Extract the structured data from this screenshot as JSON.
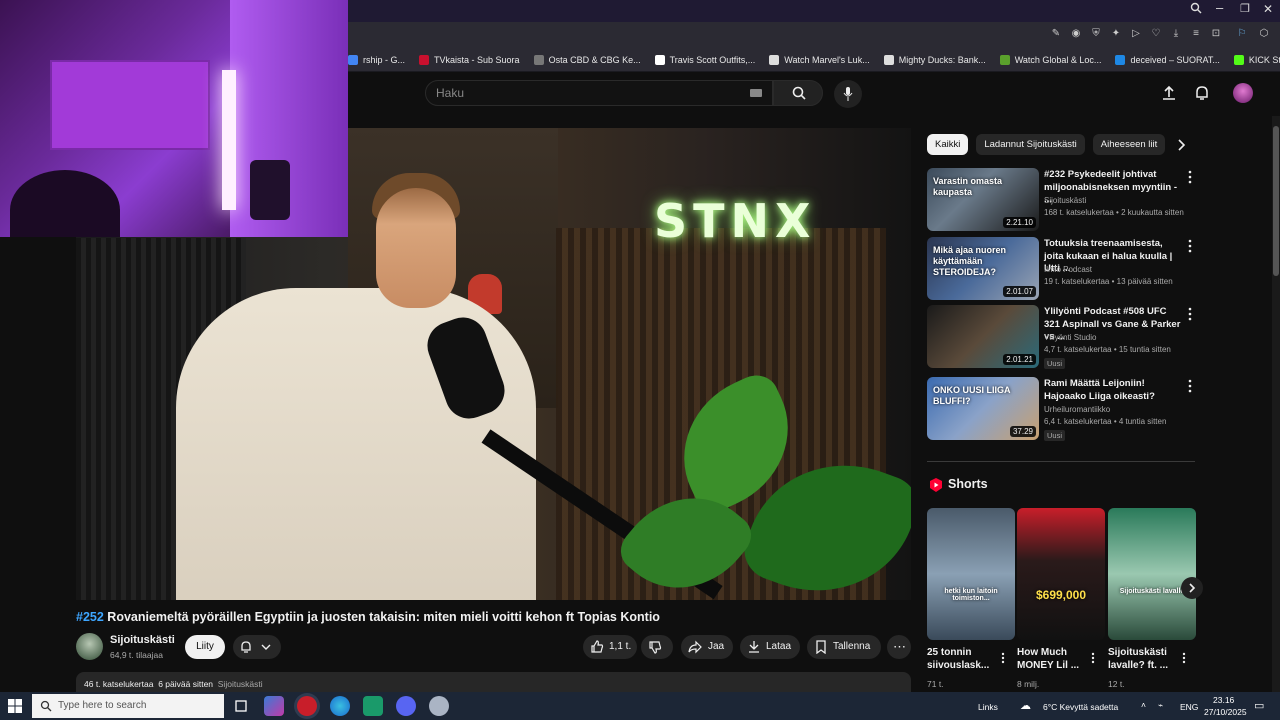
{
  "browser": {
    "bookmarks": [
      {
        "label": "rship - G...",
        "color": "#4285f4"
      },
      {
        "label": "TVkaista - Sub Suora",
        "color": "#c8102e"
      },
      {
        "label": "Osta CBD & CBG Ke...",
        "color": "#777777"
      },
      {
        "label": "Travis Scott Outfits,...",
        "color": "#ffffff"
      },
      {
        "label": "Watch Marvel's Luk...",
        "color": "#dddddd"
      },
      {
        "label": "Mighty Ducks: Bank...",
        "color": "#dddddd"
      },
      {
        "label": "Watch Global & Loc...",
        "color": "#5aa02c"
      },
      {
        "label": "deceived – SUORAT...",
        "color": "#1e88e5"
      },
      {
        "label": "KICK Status Page",
        "color": "#53fc18"
      }
    ]
  },
  "youtube": {
    "search_placeholder": "Haku",
    "video": {
      "logo_text": "STNX",
      "hashtag": "#252",
      "title": "Rovaniemeltä pyöräillen Egyptiin ja juosten takaisin: miten mieli voitti kehon ft Topias Kontio",
      "channel": "Sijoituskästi",
      "subscribers": "64,9 t. tilaajaa",
      "join_label": "Liity",
      "likes": "1,1 t.",
      "share_label": "Jaa",
      "download_label": "Lataa",
      "save_label": "Tallenna",
      "views": "46 t. katselukertaa",
      "age": "6 päivää sitten",
      "desc_channel": "Sijoituskästi"
    },
    "chips": [
      "Kaikki",
      "Ladannut Sijoituskästi",
      "Aiheeseen liit"
    ],
    "recommendations": [
      {
        "title": "#232 Psykedeelit johtivat miljoonabisneksen myyntiin - ...",
        "channel": "Sijoituskästi",
        "meta": "168 t. katselukertaa • 2 kuukautta sitten",
        "duration": "2.21.10",
        "thumb_text": "Varastin omasta kaupasta",
        "badge": ""
      },
      {
        "title": "Totuuksia treenaamisesta, joita kukaan ei halua kuulla | Utti ...",
        "channel": "Ilmiö Podcast",
        "meta": "19 t. katselukertaa • 13 päivää sitten",
        "duration": "2.01.07",
        "thumb_text": "Mikä ajaa nuoren käyttämään STEROIDEJA?",
        "badge": ""
      },
      {
        "title": "Ylilyönti Podcast #508 UFC 321 Aspinall vs Gane & Parker vs ...",
        "channel": "Ylilyönti Studio",
        "meta": "4,7 t. katselukertaa • 15 tuntia sitten",
        "duration": "2.01.21",
        "thumb_text": "",
        "badge": "Uusi"
      },
      {
        "title": "Rami Määttä Leijoniin! Hajoaako Liiga oikeasti?",
        "channel": "Urheiluromantiikko",
        "meta": "6,4 t. katselukertaa • 4 tuntia sitten",
        "duration": "37.29",
        "thumb_text": "ONKO UUSI LIIGA BLUFFI?",
        "badge": "Uusi"
      }
    ],
    "shorts_header": "Shorts",
    "shorts": [
      {
        "title": "25 tonnin siivouslask...",
        "views": "71 t.",
        "overlay": "hetki kun laitoin toimiston..."
      },
      {
        "title": "How Much MONEY Lil ...",
        "views": "8 milj.",
        "overlay": "$699,000"
      },
      {
        "title": "Sijoituskästi lavalle? ft. ...",
        "views": "12 t.",
        "overlay": "Sijoituskästi lavalle"
      }
    ]
  },
  "taskbar": {
    "search_placeholder": "Type here to search",
    "links_label": "Links",
    "weather": "6°C  Kevyttä sadetta",
    "lang": "ENG",
    "time": "23.16",
    "date": "27/10/2025"
  },
  "colors": {
    "accent": "#3ea6ff",
    "youtube_red": "#ff0033",
    "bg": "#0f0f0f"
  }
}
